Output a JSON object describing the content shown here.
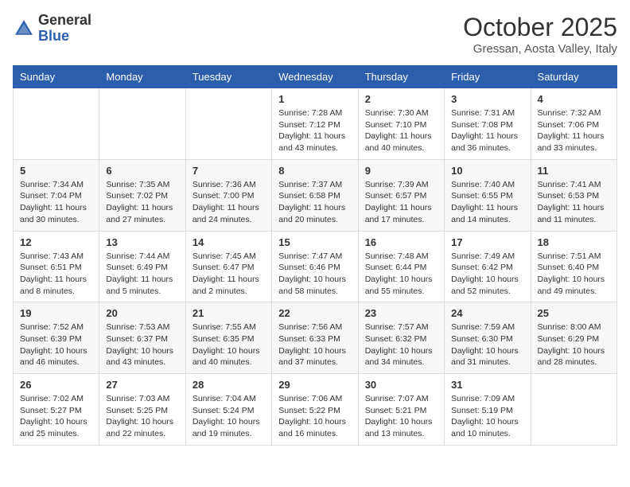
{
  "header": {
    "logo_general": "General",
    "logo_blue": "Blue",
    "month": "October 2025",
    "location": "Gressan, Aosta Valley, Italy"
  },
  "days_of_week": [
    "Sunday",
    "Monday",
    "Tuesday",
    "Wednesday",
    "Thursday",
    "Friday",
    "Saturday"
  ],
  "weeks": [
    [
      {
        "day": "",
        "info": ""
      },
      {
        "day": "",
        "info": ""
      },
      {
        "day": "",
        "info": ""
      },
      {
        "day": "1",
        "info": "Sunrise: 7:28 AM\nSunset: 7:12 PM\nDaylight: 11 hours and 43 minutes."
      },
      {
        "day": "2",
        "info": "Sunrise: 7:30 AM\nSunset: 7:10 PM\nDaylight: 11 hours and 40 minutes."
      },
      {
        "day": "3",
        "info": "Sunrise: 7:31 AM\nSunset: 7:08 PM\nDaylight: 11 hours and 36 minutes."
      },
      {
        "day": "4",
        "info": "Sunrise: 7:32 AM\nSunset: 7:06 PM\nDaylight: 11 hours and 33 minutes."
      }
    ],
    [
      {
        "day": "5",
        "info": "Sunrise: 7:34 AM\nSunset: 7:04 PM\nDaylight: 11 hours and 30 minutes."
      },
      {
        "day": "6",
        "info": "Sunrise: 7:35 AM\nSunset: 7:02 PM\nDaylight: 11 hours and 27 minutes."
      },
      {
        "day": "7",
        "info": "Sunrise: 7:36 AM\nSunset: 7:00 PM\nDaylight: 11 hours and 24 minutes."
      },
      {
        "day": "8",
        "info": "Sunrise: 7:37 AM\nSunset: 6:58 PM\nDaylight: 11 hours and 20 minutes."
      },
      {
        "day": "9",
        "info": "Sunrise: 7:39 AM\nSunset: 6:57 PM\nDaylight: 11 hours and 17 minutes."
      },
      {
        "day": "10",
        "info": "Sunrise: 7:40 AM\nSunset: 6:55 PM\nDaylight: 11 hours and 14 minutes."
      },
      {
        "day": "11",
        "info": "Sunrise: 7:41 AM\nSunset: 6:53 PM\nDaylight: 11 hours and 11 minutes."
      }
    ],
    [
      {
        "day": "12",
        "info": "Sunrise: 7:43 AM\nSunset: 6:51 PM\nDaylight: 11 hours and 8 minutes."
      },
      {
        "day": "13",
        "info": "Sunrise: 7:44 AM\nSunset: 6:49 PM\nDaylight: 11 hours and 5 minutes."
      },
      {
        "day": "14",
        "info": "Sunrise: 7:45 AM\nSunset: 6:47 PM\nDaylight: 11 hours and 2 minutes."
      },
      {
        "day": "15",
        "info": "Sunrise: 7:47 AM\nSunset: 6:46 PM\nDaylight: 10 hours and 58 minutes."
      },
      {
        "day": "16",
        "info": "Sunrise: 7:48 AM\nSunset: 6:44 PM\nDaylight: 10 hours and 55 minutes."
      },
      {
        "day": "17",
        "info": "Sunrise: 7:49 AM\nSunset: 6:42 PM\nDaylight: 10 hours and 52 minutes."
      },
      {
        "day": "18",
        "info": "Sunrise: 7:51 AM\nSunset: 6:40 PM\nDaylight: 10 hours and 49 minutes."
      }
    ],
    [
      {
        "day": "19",
        "info": "Sunrise: 7:52 AM\nSunset: 6:39 PM\nDaylight: 10 hours and 46 minutes."
      },
      {
        "day": "20",
        "info": "Sunrise: 7:53 AM\nSunset: 6:37 PM\nDaylight: 10 hours and 43 minutes."
      },
      {
        "day": "21",
        "info": "Sunrise: 7:55 AM\nSunset: 6:35 PM\nDaylight: 10 hours and 40 minutes."
      },
      {
        "day": "22",
        "info": "Sunrise: 7:56 AM\nSunset: 6:33 PM\nDaylight: 10 hours and 37 minutes."
      },
      {
        "day": "23",
        "info": "Sunrise: 7:57 AM\nSunset: 6:32 PM\nDaylight: 10 hours and 34 minutes."
      },
      {
        "day": "24",
        "info": "Sunrise: 7:59 AM\nSunset: 6:30 PM\nDaylight: 10 hours and 31 minutes."
      },
      {
        "day": "25",
        "info": "Sunrise: 8:00 AM\nSunset: 6:29 PM\nDaylight: 10 hours and 28 minutes."
      }
    ],
    [
      {
        "day": "26",
        "info": "Sunrise: 7:02 AM\nSunset: 5:27 PM\nDaylight: 10 hours and 25 minutes."
      },
      {
        "day": "27",
        "info": "Sunrise: 7:03 AM\nSunset: 5:25 PM\nDaylight: 10 hours and 22 minutes."
      },
      {
        "day": "28",
        "info": "Sunrise: 7:04 AM\nSunset: 5:24 PM\nDaylight: 10 hours and 19 minutes."
      },
      {
        "day": "29",
        "info": "Sunrise: 7:06 AM\nSunset: 5:22 PM\nDaylight: 10 hours and 16 minutes."
      },
      {
        "day": "30",
        "info": "Sunrise: 7:07 AM\nSunset: 5:21 PM\nDaylight: 10 hours and 13 minutes."
      },
      {
        "day": "31",
        "info": "Sunrise: 7:09 AM\nSunset: 5:19 PM\nDaylight: 10 hours and 10 minutes."
      },
      {
        "day": "",
        "info": ""
      }
    ]
  ]
}
